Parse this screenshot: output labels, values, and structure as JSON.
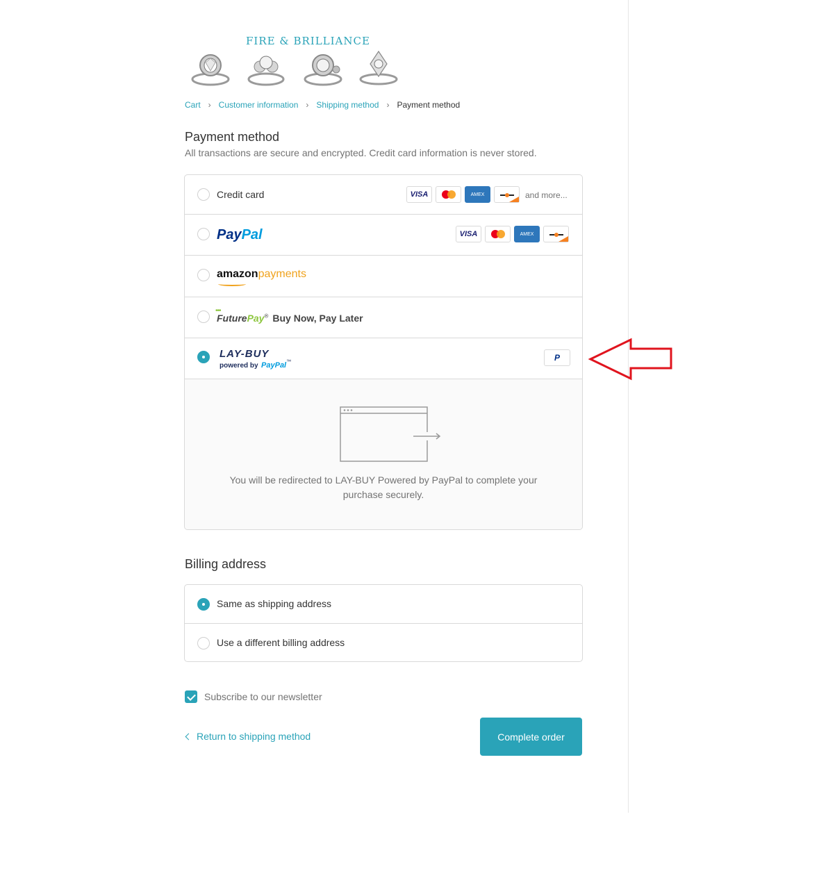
{
  "brand": {
    "name": "FIRE & BRILLIANCE"
  },
  "breadcrumb": {
    "items": [
      "Cart",
      "Customer information",
      "Shipping method"
    ],
    "current": "Payment method",
    "separator": "›"
  },
  "payment": {
    "title": "Payment method",
    "subtitle": "All transactions are secure and encrypted. Credit card information is never stored.",
    "credit_card_label": "Credit card",
    "and_more": "and more...",
    "card_icons": {
      "visa": "VISA",
      "amex": "AMEX"
    },
    "paypal_logo": {
      "a": "Pay",
      "b": "Pal"
    },
    "amazon_logo": {
      "a": "amazon",
      "b": "payments"
    },
    "futurepay": {
      "a": "Future",
      "b": "Pay",
      "tm": "®",
      "tagline": "Buy Now, Pay Later"
    },
    "laybuy": {
      "main": "LAY-BUY",
      "sub": "powered by",
      "pp": "PayPal",
      "tm": "™"
    },
    "laybuy_badge": "P",
    "selected": "lay-buy",
    "redirect_text": "You will be redirected to LAY-BUY Powered by PayPal to complete your purchase securely."
  },
  "billing": {
    "title": "Billing address",
    "options": [
      "Same as shipping address",
      "Use a different billing address"
    ],
    "selected": 0
  },
  "newsletter": {
    "label": "Subscribe to our newsletter",
    "checked": true
  },
  "actions": {
    "return_label": "Return to shipping method",
    "complete_label": "Complete order"
  },
  "colors": {
    "accent": "#2aa3b8",
    "annotation": "#e0141e"
  }
}
